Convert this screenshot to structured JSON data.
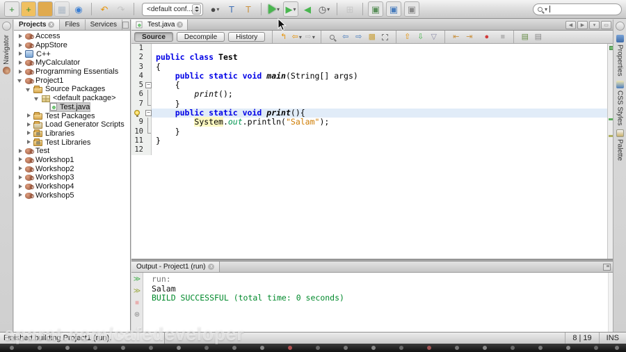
{
  "toolbar": {
    "config_combo": {
      "value": "<default conf..."
    },
    "search": {
      "value": ""
    },
    "groups": {
      "file": [
        {
          "name": "new-file",
          "ch": "+",
          "fg": "#2e8b2e",
          "boxed": true
        },
        {
          "name": "new-project",
          "ch": "+",
          "fg": "#2e8b2e",
          "bg": "#f0c060",
          "boxed": true
        },
        {
          "name": "open-project",
          "ch": "",
          "bg": "#e0aa4e",
          "boxed": true
        },
        {
          "name": "save-all",
          "ch": "▦",
          "fg": "#8aa0b8",
          "boxed": true,
          "disabled": true
        },
        {
          "name": "preview-eye",
          "ch": "◉",
          "fg": "#3b7fd4"
        }
      ],
      "undo_redo": [
        {
          "name": "undo",
          "ch": "↶",
          "fg": "#e6930a"
        },
        {
          "name": "redo",
          "ch": "↷",
          "fg": "#b0b0b0",
          "disabled": true
        }
      ],
      "build": [
        {
          "name": "deploy-globe",
          "ch": "●",
          "fg": "#4a4a4a",
          "caret": true
        },
        {
          "name": "build-hammer",
          "ch": "T",
          "fg": "#3f6fb5"
        },
        {
          "name": "clean-and-build-hammer",
          "ch": "T",
          "fg": "#c9913f"
        }
      ],
      "run_extra": [
        {
          "name": "debug-project",
          "ch": "▶",
          "fg": "#49b64f",
          "boxed": true,
          "caret": true
        },
        {
          "name": "rerun-project",
          "ch": "◀",
          "fg": "#49b64f"
        },
        {
          "name": "profile-project",
          "ch": "◷",
          "fg": "#555",
          "caret": true
        }
      ],
      "disabled_group": [
        {
          "name": "connect-diagram",
          "ch": "⊞",
          "fg": "#b5b5b5",
          "disabled": true
        }
      ],
      "monitor": [
        {
          "name": "apply-code-changes",
          "ch": "▣",
          "fg": "#5a8f5a",
          "boxed": true
        },
        {
          "name": "take-snapshot",
          "ch": "▣",
          "fg": "#4a7dbd",
          "boxed": true
        },
        {
          "name": "vm-telemetry",
          "ch": "▣",
          "fg": "#8a8a8a",
          "boxed": true
        }
      ]
    }
  },
  "left_strip": {
    "label": "Navigator"
  },
  "right_strip": {
    "tabs": [
      {
        "label": "Properties",
        "icon": "props"
      },
      {
        "label": "CSS Styles",
        "icon": "css"
      },
      {
        "label": "Palette",
        "icon": "palette"
      }
    ]
  },
  "projects_panel": {
    "tabs": [
      {
        "label": "Projects",
        "active": true,
        "closable": true
      },
      {
        "label": "Files"
      },
      {
        "label": "Services"
      }
    ],
    "tree": [
      {
        "label": "Access",
        "icon": "cup",
        "level": 0,
        "expand": "c"
      },
      {
        "label": "AppStore",
        "icon": "cup",
        "level": 0,
        "expand": "c"
      },
      {
        "label": "C++",
        "icon": "cpp",
        "level": 0,
        "expand": "c"
      },
      {
        "label": "MyCalculator",
        "icon": "cup",
        "level": 0,
        "expand": "c"
      },
      {
        "label": "Programming Essentials",
        "icon": "cup",
        "level": 0,
        "expand": "c"
      },
      {
        "label": "Project1",
        "icon": "cup",
        "level": 0,
        "expand": "e"
      },
      {
        "label": "Source Packages",
        "icon": "srcfolder",
        "level": 1,
        "expand": "e"
      },
      {
        "label": "<default package>",
        "icon": "package",
        "level": 2,
        "expand": "e"
      },
      {
        "label": "Test.java",
        "icon": "java",
        "level": 3,
        "expand": "n",
        "selected": true
      },
      {
        "label": "Test Packages",
        "icon": "srcfolder",
        "level": 1,
        "expand": "c"
      },
      {
        "label": "Load Generator Scripts",
        "icon": "folder",
        "level": 1,
        "expand": "c"
      },
      {
        "label": "Libraries",
        "icon": "lib",
        "level": 1,
        "expand": "c"
      },
      {
        "label": "Test Libraries",
        "icon": "lib",
        "level": 1,
        "expand": "c"
      },
      {
        "label": "Test",
        "icon": "cup",
        "level": 0,
        "expand": "c"
      },
      {
        "label": "Workshop1",
        "icon": "cup",
        "level": 0,
        "expand": "c"
      },
      {
        "label": "Workshop2",
        "icon": "cup",
        "level": 0,
        "expand": "c"
      },
      {
        "label": "Workshop3",
        "icon": "cup",
        "level": 0,
        "expand": "c"
      },
      {
        "label": "Workshop4",
        "icon": "cup",
        "level": 0,
        "expand": "c"
      },
      {
        "label": "Workshop5",
        "icon": "cup",
        "level": 0,
        "expand": "c"
      }
    ]
  },
  "editor": {
    "tab": {
      "label": "Test.java"
    },
    "buttons": [
      "Source",
      "Decompile",
      "History"
    ],
    "toolbar_icons": {
      "nav": [
        {
          "name": "last-edit-location",
          "ch": "↰",
          "fg": "#e6930a"
        },
        {
          "name": "back",
          "ch": "⇦",
          "fg": "#e6930a",
          "caret": true
        },
        {
          "name": "forward",
          "ch": "⇨",
          "fg": "#b8b8b8",
          "caret": true,
          "disabled": true
        }
      ],
      "find": [
        {
          "name": "find-selection",
          "mag": true
        },
        {
          "name": "find-previous-occurrence",
          "ch": "⇦",
          "fg": "#4a7dbd"
        },
        {
          "name": "find-next-occurrence",
          "ch": "⇨",
          "fg": "#4a7dbd"
        },
        {
          "name": "toggle-highlight-search",
          "ch": "▩",
          "fg": "#c9a23f"
        },
        {
          "name": "toggle-rectangular-selection",
          "box": true
        }
      ],
      "bookmarks": [
        {
          "name": "previous-bookmark",
          "ch": "⇧",
          "fg": "#e6930a"
        },
        {
          "name": "next-bookmark",
          "ch": "⇩",
          "fg": "#49b64f"
        },
        {
          "name": "toggle-bookmark",
          "ch": "▽",
          "fg": "#8a8aa8"
        }
      ],
      "indent": [
        {
          "name": "shift-line-left",
          "ch": "⇤",
          "fg": "#c9913f"
        },
        {
          "name": "shift-line-right",
          "ch": "⇥",
          "fg": "#c9913f"
        }
      ],
      "macro": [
        {
          "name": "start-macro-recording",
          "ch": "●",
          "fg": "#d23b3b"
        },
        {
          "name": "stop-macro-recording",
          "ch": "■",
          "fg": "#b8b8b8",
          "disabled": true
        }
      ],
      "comment": [
        {
          "name": "comment-lines",
          "ch": "▤",
          "fg": "#6a8f4a"
        },
        {
          "name": "uncomment-lines",
          "ch": "▤",
          "fg": "#8a8a8a"
        }
      ]
    },
    "tab_controls": [
      "scroll-left",
      "scroll-right",
      "tab-list",
      "maximize"
    ],
    "lines": [
      {
        "n": "1",
        "seg": []
      },
      {
        "n": "2",
        "seg": [
          {
            "t": "public class ",
            "s": "kw"
          },
          {
            "t": "Test",
            "s": "bold"
          }
        ]
      },
      {
        "n": "3",
        "seg": [
          {
            "t": "{",
            "s": "p"
          }
        ]
      },
      {
        "n": "4",
        "seg": [
          {
            "t": "    ",
            "s": "p"
          },
          {
            "t": "public static void ",
            "s": "kw"
          },
          {
            "t": "main",
            "s": "bi"
          },
          {
            "t": "(String[] args)",
            "s": "p"
          }
        ]
      },
      {
        "n": "5",
        "fold": "open",
        "seg": [
          {
            "t": "    {",
            "s": "p"
          }
        ]
      },
      {
        "n": "6",
        "fold": "line",
        "seg": [
          {
            "t": "        ",
            "s": "p"
          },
          {
            "t": "print",
            "s": "i"
          },
          {
            "t": "();",
            "s": "p"
          }
        ]
      },
      {
        "n": "7",
        "fold": "end",
        "seg": [
          {
            "t": "    }",
            "s": "p"
          }
        ]
      },
      {
        "n": "8",
        "bulb": true,
        "hl": true,
        "fold": "open",
        "seg": [
          {
            "t": "    ",
            "s": "p"
          },
          {
            "t": "public static void ",
            "s": "kw"
          },
          {
            "t": "print",
            "s": "bi"
          },
          {
            "t": "(){",
            "s": "p"
          }
        ]
      },
      {
        "n": "9",
        "fold": "line",
        "seg": [
          {
            "t": "        ",
            "s": "p"
          },
          {
            "t": "System",
            "s": "occ"
          },
          {
            "t": ".",
            "s": "p"
          },
          {
            "t": "out",
            "s": "fld"
          },
          {
            "t": ".println(",
            "s": "p"
          },
          {
            "t": "\"Salam\"",
            "s": "str"
          },
          {
            "t": ");",
            "s": "p"
          }
        ]
      },
      {
        "n": "10",
        "fold": "end",
        "seg": [
          {
            "t": "    }",
            "s": "p"
          }
        ]
      },
      {
        "n": "11",
        "seg": [
          {
            "t": "}",
            "s": "p"
          }
        ]
      },
      {
        "n": "12",
        "seg": []
      }
    ]
  },
  "output": {
    "tab": "Output - Project1 (run)",
    "icons": [
      {
        "name": "rerun",
        "ch": "≫",
        "fg": "#3fae49"
      },
      {
        "name": "rerun-with-different-parameters",
        "ch": "≫",
        "fg": "#9aa83f"
      },
      {
        "name": "stop-build",
        "ch": "■",
        "fg": "#e8b0b0",
        "disabled": true
      },
      {
        "name": "ant-settings",
        "ch": "⊛",
        "fg": "#888888"
      }
    ],
    "lines": [
      {
        "text": "run:",
        "style": "muted"
      },
      {
        "text": "Salam",
        "style": "plain"
      },
      {
        "text": "BUILD SUCCESSFUL (total time: 0 seconds)",
        "style": "success"
      }
    ]
  },
  "statusbar": {
    "message": "Finished building Project1 (run).",
    "caret_position": "8 | 19",
    "insert_mode": "INS"
  },
  "watermark": "aparat.com/cafedeveloper",
  "colors": {
    "keyword": "#0000e6",
    "string": "#ce7b00",
    "static_field": "#009651",
    "build_success": "#00892b",
    "current_line": "#e1ecf8",
    "occurrence_highlight": "#fdf9c2",
    "run_accent": "#49b64f"
  }
}
